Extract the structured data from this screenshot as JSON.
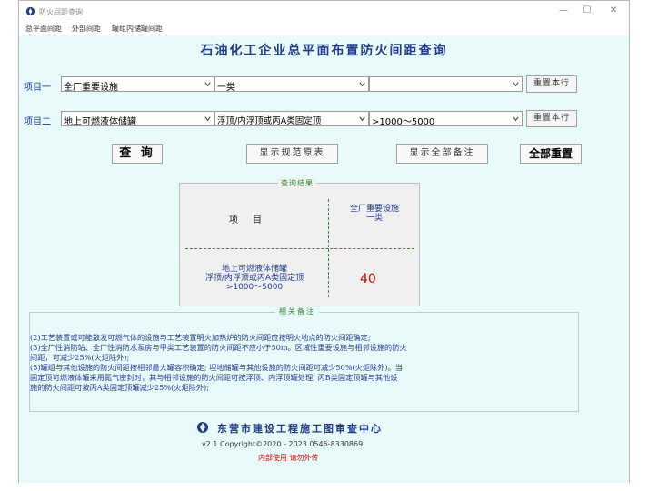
{
  "window": {
    "title": "防火间距查询",
    "minimize": "—",
    "maximize": "☐",
    "close": "✕"
  },
  "menu": [
    "总平面间距",
    "外部间距",
    "罐组内储罐间距"
  ],
  "main_title": "石油化工企业总平面布置防火间距查询",
  "row1": {
    "label": "项目一",
    "combo1": "全厂重要设施",
    "combo2": "一类",
    "combo3": "",
    "reset": "重置本行"
  },
  "row2": {
    "label": "项目二",
    "combo1": "地上可燃液体储罐",
    "combo2": "浮顶/内浮顶或丙A类固定顶",
    "combo3": ">1000～5000",
    "reset": "重置本行"
  },
  "buttons": {
    "query": "查 询",
    "show_table": "显示规范原表",
    "show_notes": "显示全部备注",
    "reset_all": "全部重置"
  },
  "result": {
    "caption": "查询结果",
    "item_label": "项　目",
    "top_right_line1": "全厂重要设施",
    "top_right_line2": "一类",
    "bottom_left_line1": "地上可燃液体储罐",
    "bottom_left_line2": "浮顶/内浮顶或丙A类固定顶",
    "bottom_left_line3": ">1000～5000",
    "value": "40"
  },
  "notes": {
    "caption": "相关备注",
    "lines": [
      "(2)工艺装置或可能散发可燃气体的设施与工艺装置明火加热炉的防火间距应按明火地点的防火间距确定;",
      "(3)全厂性消防站、全厂性消防水泵房与甲类工艺装置的防火间距不应小于50m。区域性重要设施与相邻设施的防火",
      "间距，可减少25%(火炬除外);",
      "(5)罐组与其他设施的防火间距按相邻最大罐容积确定; 埋地储罐与其他设施的防火间距可减少50%(火炬除外)。当",
      "固定顶可燃液体罐采用氮气密封时，其与相邻设施的防火间距可按浮顶、内浮顶罐处理; 丙B类固定顶罐与其他设",
      "施的防火间距可按丙A类固定顶罐减少25%(火炬除外);"
    ]
  },
  "footer": {
    "org": "东营市建设工程施工图审查中心",
    "version": "v2.1  Copyright©2020 - 2023    0546-8330869",
    "warning": "内部使用  请勿外传"
  },
  "colors": {
    "background": "#e8fafa",
    "text_blue": "#1f3a8a",
    "result_red": "#d40000",
    "dash_green": "#2e8b2e"
  }
}
